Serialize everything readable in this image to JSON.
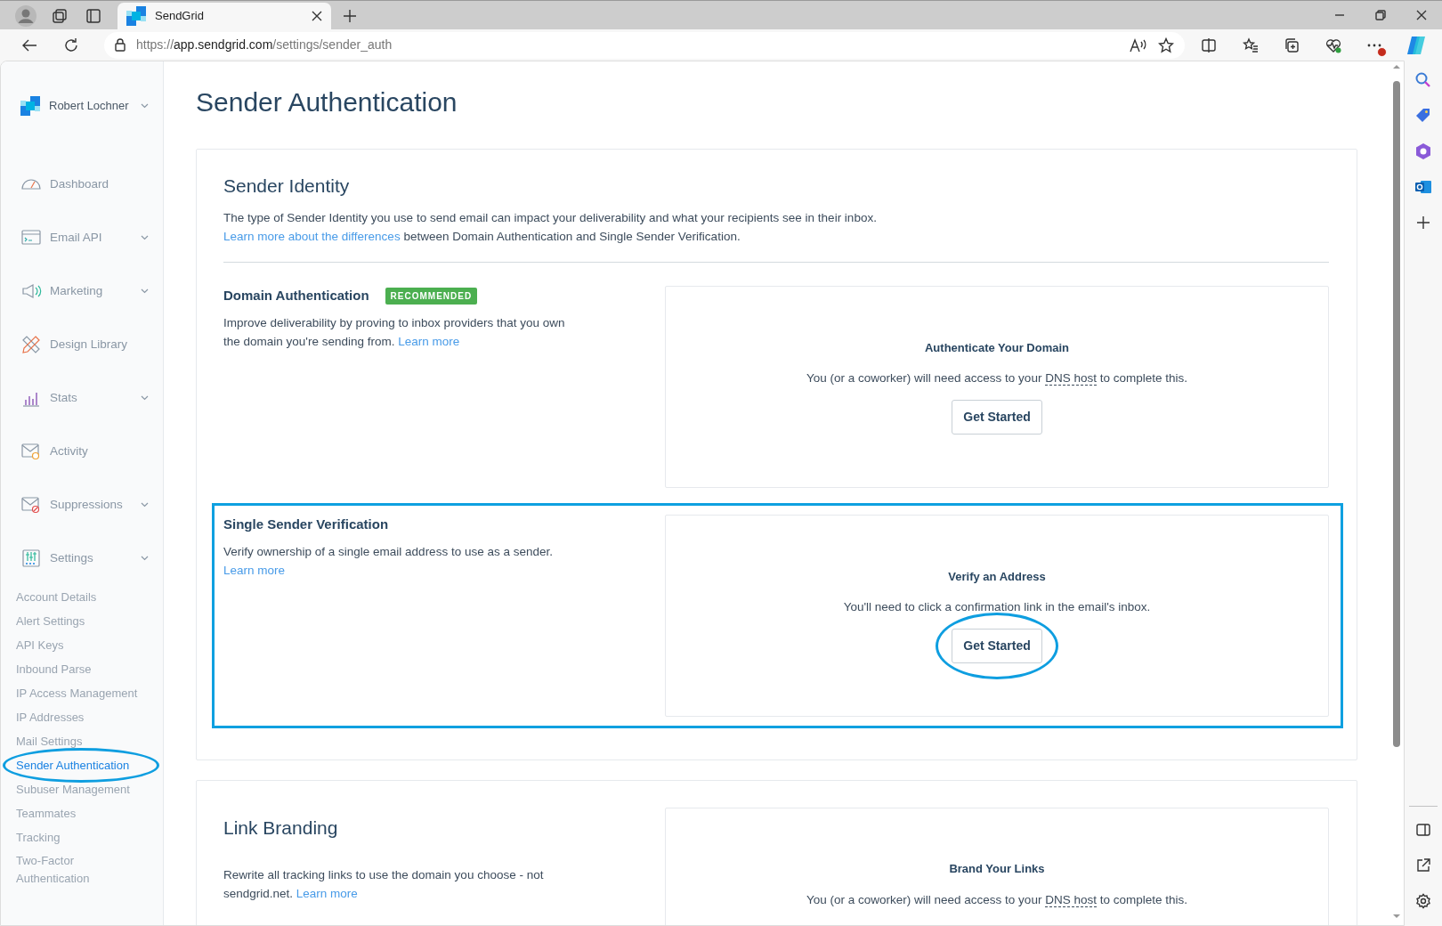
{
  "browser": {
    "tabs": [
      {
        "title": "SendGrid",
        "selected": true
      }
    ],
    "url": {
      "scheme": "https://",
      "host": "app.sendgrid.com",
      "path": "/settings/sender_auth"
    },
    "update_badge": true
  },
  "sidebar": {
    "account": "Robert Lochner",
    "items": [
      {
        "label": "Dashboard",
        "has_submenu": false
      },
      {
        "label": "Email API",
        "has_submenu": true
      },
      {
        "label": "Marketing",
        "has_submenu": true
      },
      {
        "label": "Design Library",
        "has_submenu": false
      },
      {
        "label": "Stats",
        "has_submenu": true
      },
      {
        "label": "Activity",
        "has_submenu": false
      },
      {
        "label": "Suppressions",
        "has_submenu": true
      },
      {
        "label": "Settings",
        "has_submenu": true
      }
    ],
    "subitems": [
      {
        "label": "Account Details",
        "selected": false,
        "circled": false
      },
      {
        "label": "Alert Settings",
        "selected": false,
        "circled": false
      },
      {
        "label": "API Keys",
        "selected": false,
        "circled": false
      },
      {
        "label": "Inbound Parse",
        "selected": false,
        "circled": false
      },
      {
        "label": "IP Access Management",
        "selected": false,
        "circled": false
      },
      {
        "label": "IP Addresses",
        "selected": false,
        "circled": false
      },
      {
        "label": "Mail Settings",
        "selected": false,
        "circled": false
      },
      {
        "label": "Sender Authentication",
        "selected": true,
        "circled": true
      },
      {
        "label": "Subuser Management",
        "selected": false,
        "circled": false
      },
      {
        "label": "Teammates",
        "selected": false,
        "circled": false
      },
      {
        "label": "Tracking",
        "selected": false,
        "circled": false
      },
      {
        "label": "Two-Factor Authentication",
        "selected": false,
        "circled": false
      }
    ]
  },
  "page_title": "Sender Authentication",
  "sections": [
    {
      "kind": "top_title",
      "title": "Sender Identity",
      "description": "The type of Sender Identity you use to send email can impact your deliverability and what your recipients see in their inbox.",
      "link": "Learn more about the differences",
      "link_suffix": " between Domain Authentication and Single Sender Verification.",
      "rows": [
        {
          "title": "Domain Authentication",
          "badge": "RECOMMENDED",
          "text": "Improve deliverability by proving to inbox providers that you own the domain you're sending from.",
          "link": "Learn more",
          "highlighted": false,
          "panel": {
            "title": "Authenticate Your Domain",
            "text_before": "You (or a coworker) will need access to your ",
            "term": "DNS host",
            "text_after": " to complete this.",
            "button": "Get Started",
            "button_circled": false
          }
        },
        {
          "title": "Single Sender Verification",
          "text": "Verify ownership of a single email address to use as a sender.",
          "link": "Learn more",
          "highlighted": true,
          "panel": {
            "title": "Verify an Address",
            "text_before": "You'll need to click a confirmation link in the email's inbox.",
            "button": "Get Started",
            "button_circled": true
          }
        }
      ]
    },
    {
      "kind": "side_title",
      "title": "Link Branding",
      "rows": [
        {
          "text": "Rewrite all tracking links to use the domain you choose - not sendgrid.net.",
          "link": "Learn more",
          "highlighted": false,
          "panel": {
            "title": "Brand Your Links",
            "text_before": "You (or a coworker) will need access to your ",
            "term": "DNS host",
            "text_after": " to complete this."
          }
        }
      ]
    }
  ]
}
